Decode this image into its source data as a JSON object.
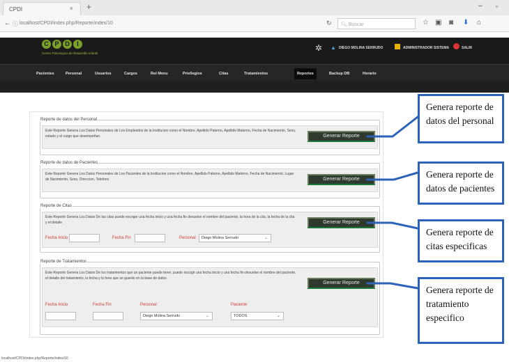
{
  "browser": {
    "tab_title": "CPDI",
    "tab_close": "×",
    "new_tab": "+",
    "url": "localhost/CPDI/index.php/Reporte/index/10",
    "search_placeholder": "Buscar",
    "window_minimize": "–",
    "window_maximize": "▫",
    "status_url": "localhost/CPDI/index.php/Reporte/index/10"
  },
  "app": {
    "logo_letters": [
      "C",
      "P",
      "D",
      "I"
    ],
    "logo_subtitle": "Centro Psicologico de Desarrollo Infantil",
    "user_name": "DIEGO MOLINA SERRUDO",
    "role": "ADMINISTRADOR SISTEMA",
    "exit_label": "SALIR",
    "accent_color": "#7aa02a"
  },
  "menu": {
    "items": [
      "Pacientes",
      "Personal",
      "Usuarios",
      "Cargos",
      "Rol Menu",
      "Privilegios",
      "Citas",
      "Tratamientos",
      "Reportes",
      "Backup DB",
      "Horario"
    ],
    "active": "Reportes"
  },
  "sections": {
    "personal": {
      "legend": "Reporte de datos del Personal",
      "description": "Este Reporte Genera Los Datos Personales de Los Empleados de la Institucion como el Nombre, Apellido Paterno, Apellido Materno, Fecha de Nacimiento, Sexo, estado y el cargo que desempeñan.",
      "button": "Generar Reporte"
    },
    "pacientes": {
      "legend": "Reporte de datos de Pacientes",
      "description": "Este Reporte Genera Los Datos Personales de Los Pacientes de la Institucion como el Nombre, Apellido Paterno, Apellido Materno, Fecha de Nacimiento, Lugar de Nacimiento, Sexo, Direccion, Telefono",
      "button": "Generar Reporte"
    },
    "citas": {
      "legend": "Reporte de Citas",
      "description": "Este Reporte Genera Los Datos De las citas puede escoger una fecha inicio y una fecha fin devuelve el nombre del paciente, la hora de la cita, la fecha de la cita y el detalle",
      "button": "Generar Reporte",
      "fecha_inicio_label": "Fecha Inicio",
      "fecha_fin_label": "Fecha Fin",
      "personal_label": "Personal",
      "personal_value": "Diego Molina Serrudo"
    },
    "tratamientos": {
      "legend": "Reporte de Tratamientos",
      "description": "Este Reporte Genera Los Datos De los tratamientos que un paciente puede tener, puede escogir una fecha inicio y una fecha fin devuelve el nombre del paciente, el detalle del tratamiento, la fecha y la hora que se guardo en la base de datos",
      "button": "Generar Reporte",
      "fecha_inicio_label": "Fecha Inicio",
      "fecha_fin_label": "Fecha Fin",
      "personal_label": "Personal",
      "personal_value": "Diego Molina Serrudo",
      "paciente_label": "Paciente",
      "paciente_value": "TODOS"
    }
  },
  "annotations": [
    "Genera reporte de datos del personal",
    "Genera reporte de datos de pacientes",
    "Genera reporte de citas especificas",
    "Genera reporte de tratamiento especifico"
  ],
  "annotation_color": "#2c62b8"
}
